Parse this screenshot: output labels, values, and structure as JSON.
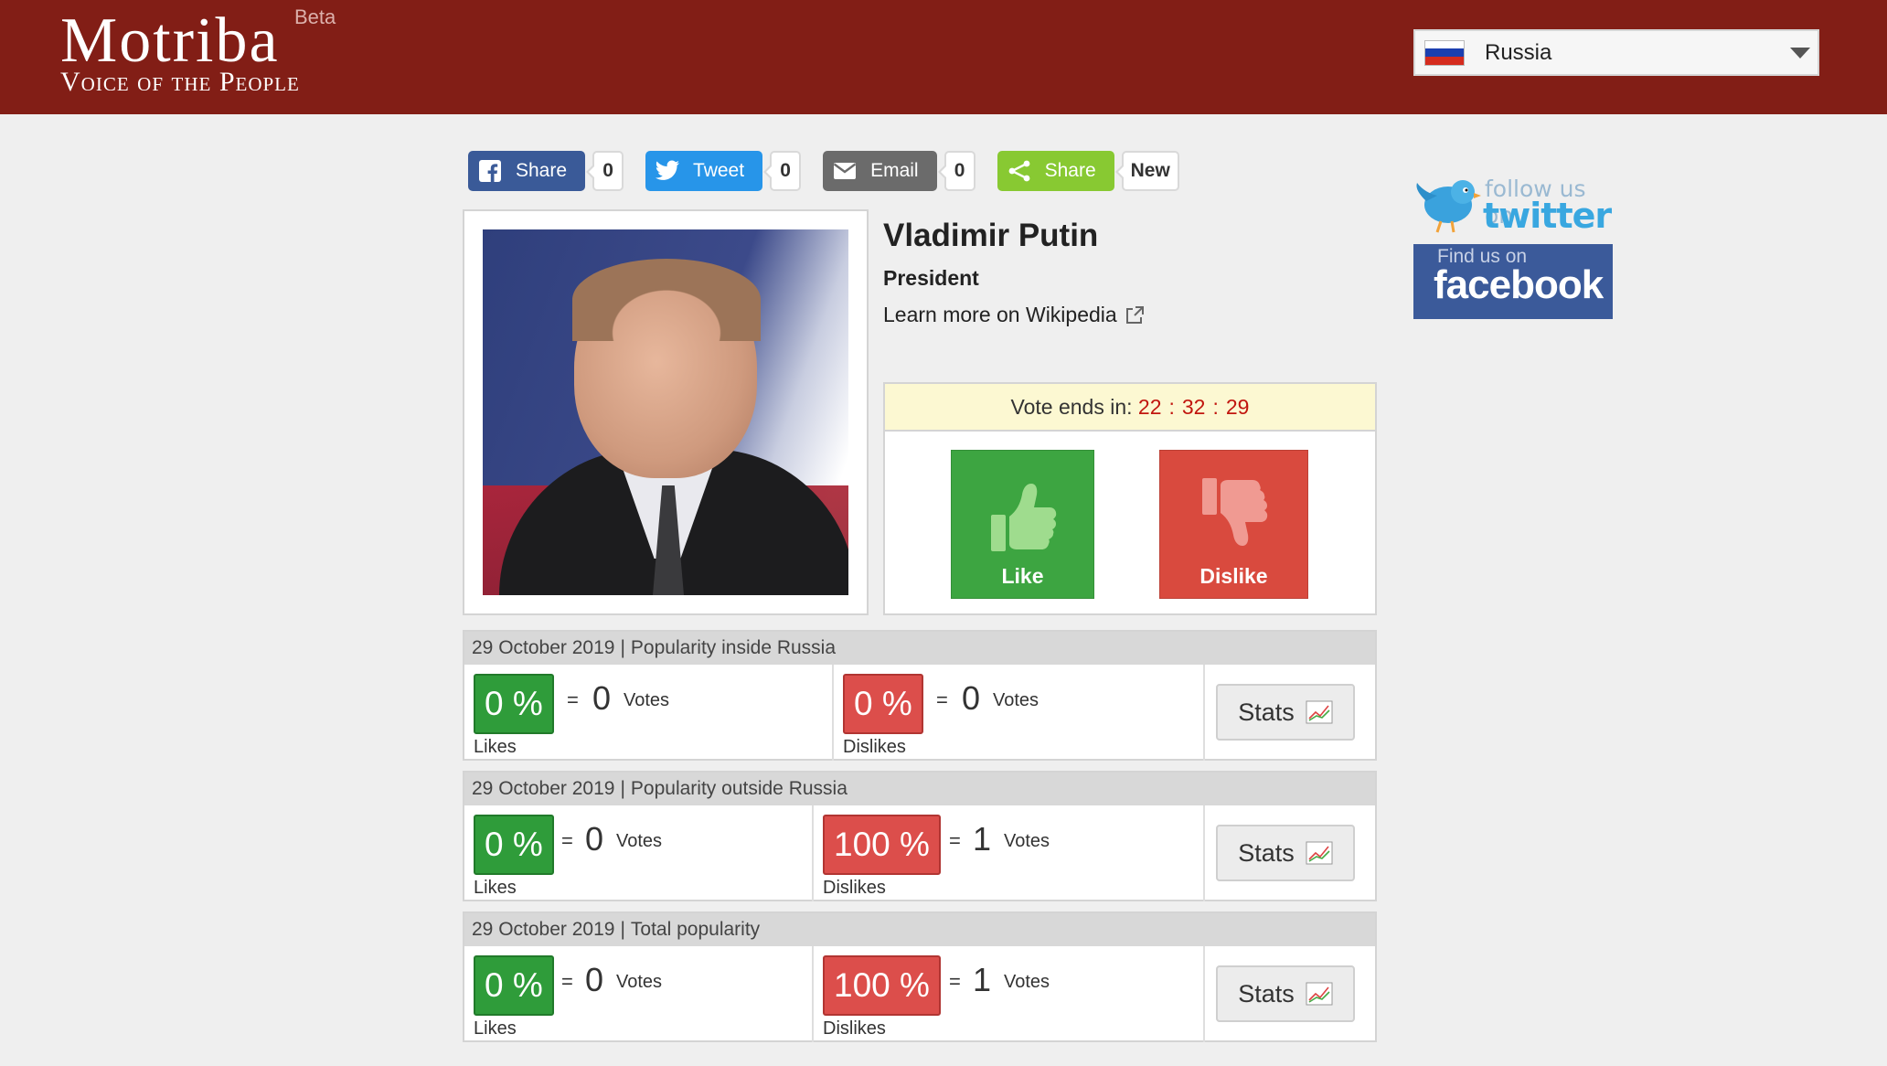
{
  "header": {
    "logo_main": "Motriba",
    "logo_sub": "Voice of the People",
    "logo_badge": "Beta",
    "country": "Russia"
  },
  "share": {
    "facebook": {
      "label": "Share",
      "count": "0"
    },
    "twitter": {
      "label": "Tweet",
      "count": "0"
    },
    "email": {
      "label": "Email",
      "count": "0"
    },
    "generic": {
      "label": "Share",
      "count": "New"
    }
  },
  "profile": {
    "name": "Vladimir Putin",
    "title": "President",
    "wiki_link": "Learn more on Wikipedia"
  },
  "vote": {
    "ends_label": "Vote ends in:",
    "hours": "22",
    "minutes": "32",
    "seconds": "29",
    "like_label": "Like",
    "dislike_label": "Dislike"
  },
  "panels": [
    {
      "date": "29 October 2019",
      "title": "Popularity inside Russia",
      "likes_pct": "0 %",
      "likes_votes": "0",
      "dislikes_pct": "0 %",
      "dislikes_votes": "0"
    },
    {
      "date": "29 October 2019",
      "title": "Popularity outside Russia",
      "likes_pct": "0 %",
      "likes_votes": "0",
      "dislikes_pct": "100 %",
      "dislikes_votes": "1"
    },
    {
      "date": "29 October 2019",
      "title": "Total popularity",
      "likes_pct": "0 %",
      "likes_votes": "0",
      "dislikes_pct": "100 %",
      "dislikes_votes": "1"
    }
  ],
  "labels": {
    "equals": "=",
    "votes": "Votes",
    "likes": "Likes",
    "dislikes": "Dislikes",
    "stats": "Stats",
    "separator": "|",
    "colon": ":"
  },
  "social": {
    "twitter_line1": "follow us on",
    "twitter_line2": "twitter",
    "facebook_line1": "Find us on",
    "facebook_line2": "facebook"
  },
  "colors": {
    "header_bg": "#821e16",
    "like_green": "#3da541",
    "dislike_red": "#d94a3e",
    "timer_red": "#c1160f"
  }
}
